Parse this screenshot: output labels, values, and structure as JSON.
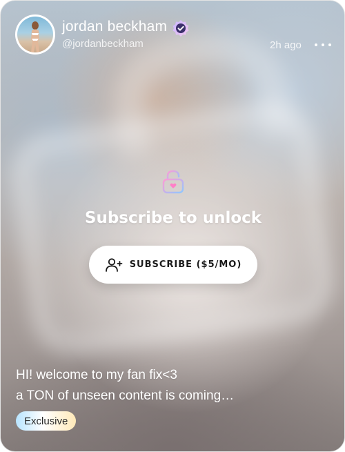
{
  "post": {
    "author_name": "jordan beckham",
    "author_handle": "@jordanbeckham",
    "time_ago": "2h ago",
    "lock": {
      "title": "Subscribe to unlock",
      "subscribe_label": "SUBSCRIBE ($5/MO)"
    },
    "caption_lines": [
      "HI! welcome to my fan fix<3",
      "a TON of unseen content is coming…"
    ],
    "badge": "Exclusive"
  },
  "icons": {
    "verified": "verified-badge-icon",
    "more": "more-dots-icon",
    "lock": "lock-heart-icon",
    "subscribe": "add-user-icon"
  },
  "colors": {
    "verified_badge": "#7b6fd8",
    "lock_gradient_start": "#ff9ad5",
    "lock_gradient_end": "#8fc7ff",
    "button_bg": "#ffffff",
    "button_text": "#1a1a1a"
  }
}
